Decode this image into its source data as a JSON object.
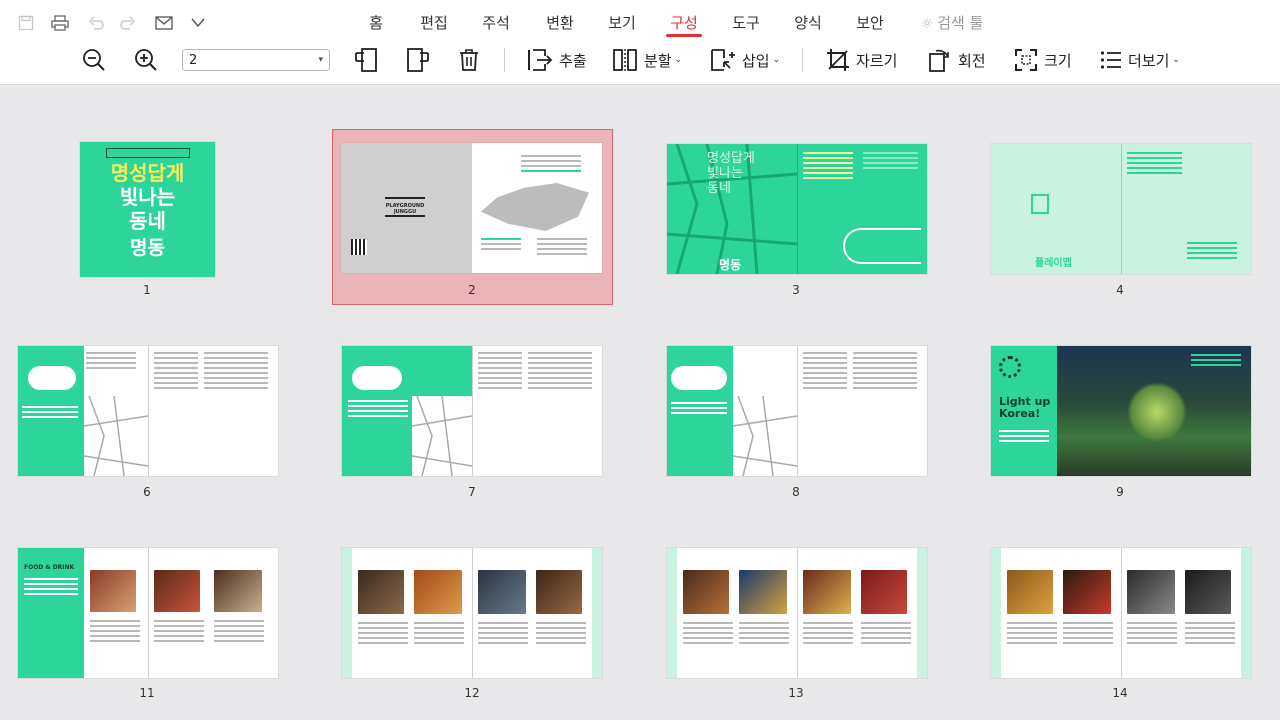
{
  "ribbon": {
    "tabs": [
      {
        "label": "홈"
      },
      {
        "label": "편집"
      },
      {
        "label": "주석"
      },
      {
        "label": "변환"
      },
      {
        "label": "보기"
      },
      {
        "label": "구성"
      },
      {
        "label": "도구"
      },
      {
        "label": "양식"
      },
      {
        "label": "보안"
      },
      {
        "label": "검색 툴"
      }
    ],
    "active_tab": "구성"
  },
  "toolbar": {
    "page_value": "2",
    "extract_label": "추출",
    "split_label": "분할",
    "insert_label": "삽입",
    "crop_label": "자르기",
    "rotate_label": "회전",
    "size_label": "크기",
    "more_label": "더보기"
  },
  "thumbnails": [
    {
      "number": "1",
      "selected": false
    },
    {
      "number": "2",
      "selected": true
    },
    {
      "number": "3",
      "selected": false
    },
    {
      "number": "4",
      "selected": false
    },
    {
      "number": "6",
      "selected": false
    },
    {
      "number": "7",
      "selected": false
    },
    {
      "number": "8",
      "selected": false
    },
    {
      "number": "9",
      "selected": false
    },
    {
      "number": "11",
      "selected": false
    },
    {
      "number": "12",
      "selected": false
    },
    {
      "number": "13",
      "selected": false
    },
    {
      "number": "14",
      "selected": false
    }
  ],
  "page_content": {
    "p1": {
      "line1": "명성답게",
      "line2": "빛나는",
      "line3": "동네",
      "line4": "명동"
    },
    "p2": {
      "logo": "PLAYGROUND JUNGGU"
    },
    "p3": {
      "title1": "명성답게",
      "title2": "빛나는",
      "title3": "동네",
      "tag": "명동"
    },
    "p4": {
      "label": "플레이맵"
    },
    "p9": {
      "line1": "Light up",
      "line2": "Korea!"
    },
    "p11": {
      "title": "FOOD & DRINK"
    }
  },
  "colors": {
    "accent": "#e0313a",
    "brand_green": "#2ed59a",
    "mint": "#c9f3e0",
    "selection_fill": "#eab4b8",
    "canvas": "#e8e8ea"
  }
}
